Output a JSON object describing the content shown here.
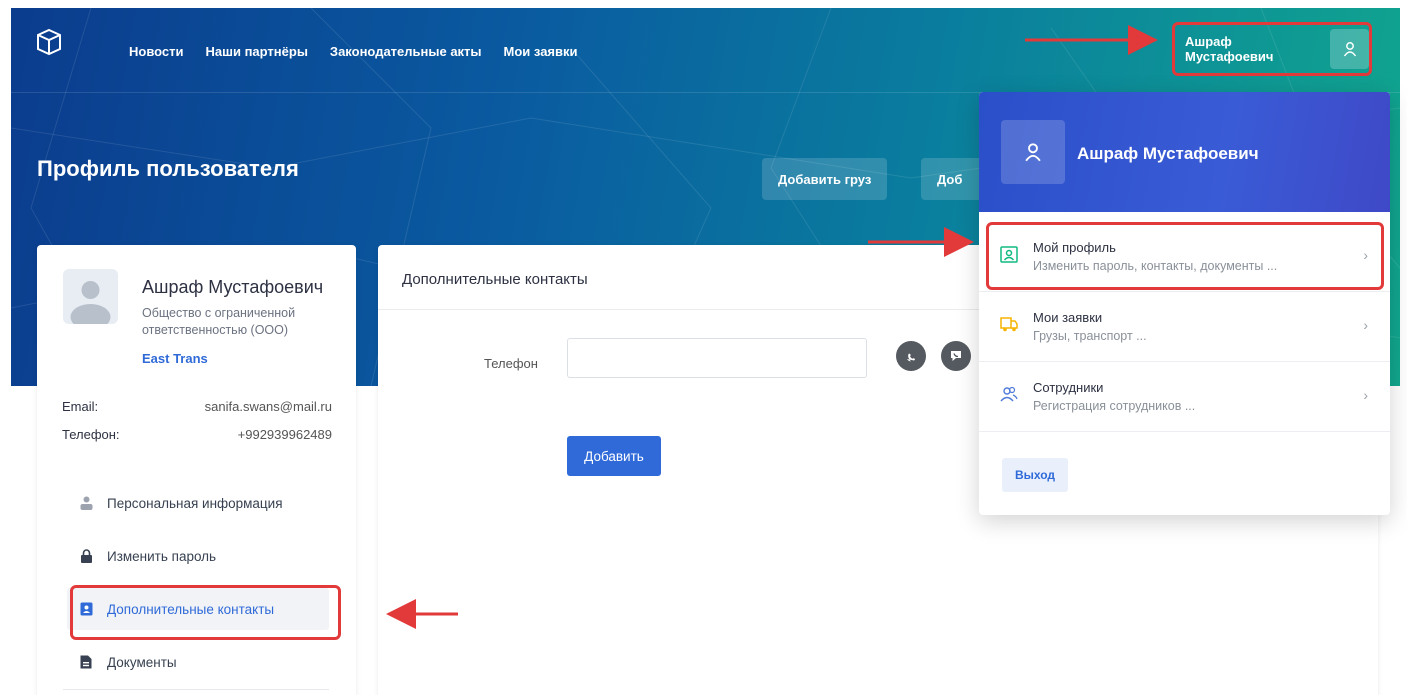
{
  "nav": {
    "items": [
      "Новости",
      "Наши партнёры",
      "Законодательные акты",
      "Мои заявки"
    ]
  },
  "user": {
    "name": "Ашраф Мустафоевич",
    "org": "Общество с ограниченной ответственностью (ООО)",
    "company": "East Trans",
    "email_label": "Email:",
    "email": "sanifa.swans@mail.ru",
    "phone_label": "Телефон:",
    "phone": "+992939962489"
  },
  "page": {
    "title": "Профиль пользователя",
    "buttons": [
      "Добавить груз",
      "Доб"
    ]
  },
  "sidebar": {
    "items": [
      {
        "label": "Персональная информация",
        "icon": "user-icon"
      },
      {
        "label": "Изменить пароль",
        "icon": "lock-icon"
      },
      {
        "label": "Дополнительные контакты",
        "icon": "contact-card-icon",
        "active": true
      },
      {
        "label": "Документы",
        "icon": "document-icon"
      }
    ]
  },
  "main": {
    "title": "Дополнительные контакты",
    "phone_label": "Телефон",
    "phone_value": "",
    "add_button": "Добавить"
  },
  "dropdown": {
    "name": "Ашраф Мустафоевич",
    "items": [
      {
        "title": "Мой профиль",
        "subtitle": "Изменить пароль, контакты, документы ...",
        "icon": "profile-icon"
      },
      {
        "title": "Мои заявки",
        "subtitle": "Грузы, транспорт ...",
        "icon": "truck-icon"
      },
      {
        "title": "Сотрудники",
        "subtitle": "Регистрация сотрудников ...",
        "icon": "employees-icon"
      }
    ],
    "logout": "Выход"
  },
  "colors": {
    "accent": "#2f6ad8",
    "annotation": "#e23a3a"
  }
}
